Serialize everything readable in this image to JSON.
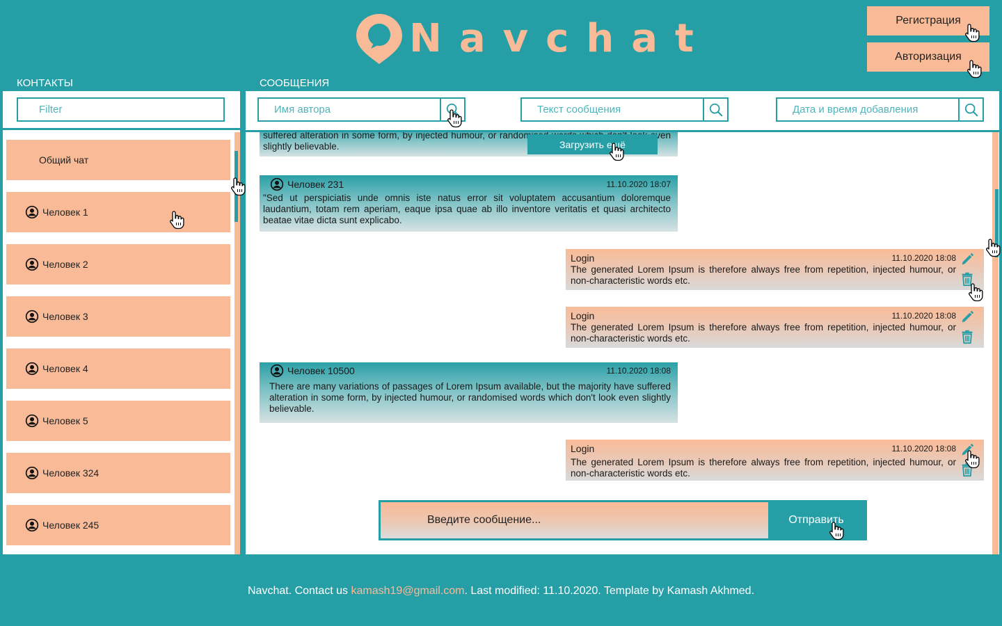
{
  "header": {
    "logo_text": "Navchat",
    "register_label": "Регистрация",
    "login_label": "Авторизация"
  },
  "contacts": {
    "title": "КОНТАКТЫ",
    "filter_placeholder": "Filter",
    "items": [
      {
        "label": "Общий чат"
      },
      {
        "label": "Человек 1"
      },
      {
        "label": "Человек 2"
      },
      {
        "label": "Человек 3"
      },
      {
        "label": "Человек 4"
      },
      {
        "label": "Человек 5"
      },
      {
        "label": "Человек 324"
      },
      {
        "label": "Человек 245"
      }
    ]
  },
  "messages": {
    "title": "СООБЩЕНИЯ",
    "search_author_placeholder": "Имя автора",
    "search_text_placeholder": "Текст сообщения",
    "search_date_placeholder": "Дата и время добавления",
    "load_more_label": "Загрузить ещё",
    "list": [
      {
        "text": "suffered alteration in some form, by injected humour, or randomised words which don't look even slightly believable."
      },
      {
        "author": "Человек 231",
        "time": "11.10.2020 18:07",
        "text": "\"Sed ut perspiciatis unde omnis iste natus error sit voluptatem accusantium doloremque laudantium, totam rem aperiam, eaque ipsa quae ab illo inventore veritatis et quasi architecto beatae vitae dicta sunt explicabo."
      },
      {
        "author": "Login",
        "time": "11.10.2020 18:08",
        "text": "The generated Lorem Ipsum is therefore always free from repetition, injected humour, or non-characteristic words etc."
      },
      {
        "author": "Login",
        "time": "11.10.2020 18:08",
        "text": "The generated Lorem Ipsum is therefore always free from repetition, injected humour, or non-characteristic words etc."
      },
      {
        "author": "Человек 10500",
        "time": "11.10.2020 18:08",
        "text": "There are many variations of passages of Lorem Ipsum available, but the majority have suffered alteration in some form, by injected humour, or randomised words which don't look even slightly believable."
      },
      {
        "author": "Login",
        "time": "11.10.2020 18:08",
        "text": "The generated Lorem Ipsum is therefore always free from repetition, injected humour, or non-characteristic words etc."
      }
    ],
    "composer_placeholder": "Введите сообщение...",
    "send_label": "Отправить"
  },
  "footer": {
    "prefix": "Navchat. Contact us ",
    "email": "kamash19@gmail.com",
    "suffix": ". Last modified: 11.10.2020. Template by Kamash Akhmed."
  },
  "colors": {
    "background": "#259ea6",
    "accent": "#f9bb97",
    "panel": "#ffffff"
  },
  "icons": [
    "map-pin-chat-logo-icon",
    "user-circle-icon",
    "search-icon",
    "pencil-icon",
    "trash-icon",
    "hand-cursor-icon"
  ]
}
